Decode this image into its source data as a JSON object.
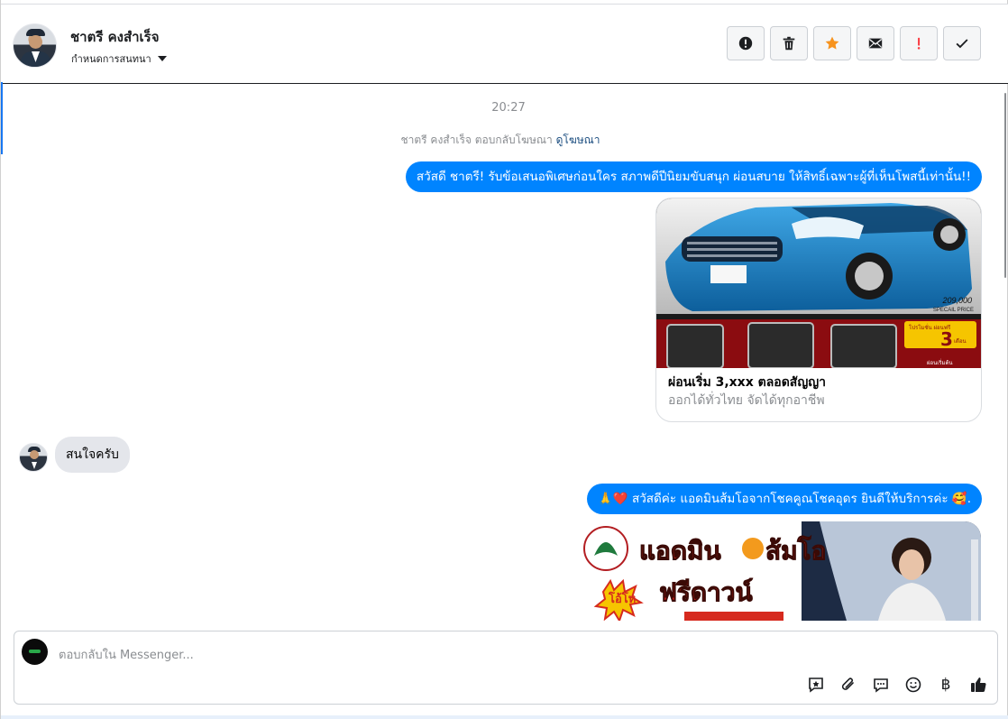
{
  "header": {
    "contact_name": "ชาตรี คงสำเร็จ",
    "assign_label": "กำหนดการสนทนา",
    "toolbar": [
      {
        "name": "spam-alert-button",
        "icon": "alert-circle-icon"
      },
      {
        "name": "delete-button",
        "icon": "trash-icon"
      },
      {
        "name": "star-button",
        "icon": "star-icon",
        "color": "#f7931e"
      },
      {
        "name": "mark-unread-button",
        "icon": "envelope-icon"
      },
      {
        "name": "follow-up-button",
        "icon": "exclamation-icon",
        "color": "#fa383e"
      },
      {
        "name": "mark-done-button",
        "icon": "check-icon"
      }
    ]
  },
  "chat": {
    "timestamp": "20:27",
    "ad_reply_text": "ชาตรี คงสำเร็จ ตอบกลับโฆษณา",
    "ad_reply_link": "ดูโฆษณา",
    "messages": [
      {
        "text": "สวัสดี ชาตรี! รับข้อเสนอพิเศษก่อนใคร สภาพดีปีนิยมขับสนุก ผ่อนสบาย ให้สิทธิ์เฉพาะผู้ที่เห็นโพสนี้เท่านั้น!!"
      },
      {
        "text": "สนใจครับ"
      },
      {
        "text": "🙏❤️ สวัสดีค่ะ แอดมินส้มโอจากโชคคูณโชคอุดร ยินดีให้บริการค่ะ 🥰."
      }
    ],
    "card": {
      "title": "ผ่อนเริ่ม 3,xxx ตลอดสัญญา",
      "subtitle": "ออกได้ทั่วไทย จัดได้ทุกอาชีพ",
      "price": "209,000",
      "price_caption": "SPECAIL PRICE",
      "promo_line": "โปรโมชั่น ผ่อนฟรี",
      "promo_number": "3",
      "promo_unit": "เดือน",
      "install_label": "ผ่อนเริ่มต้น"
    },
    "promo_banner": {
      "headline_1": "แอดมิน",
      "headline_2": "ส้มโอ",
      "tag": "โอ้โห",
      "offer": "ฟรีดาวน์"
    }
  },
  "composer": {
    "placeholder": "ตอบกลับใน Messenger...",
    "icons": [
      "saved-reply-icon",
      "attachment-icon",
      "chat-bubble-icon",
      "emoji-icon",
      "baht-icon",
      "thumbs-up-icon"
    ],
    "baht_symbol": "฿"
  }
}
